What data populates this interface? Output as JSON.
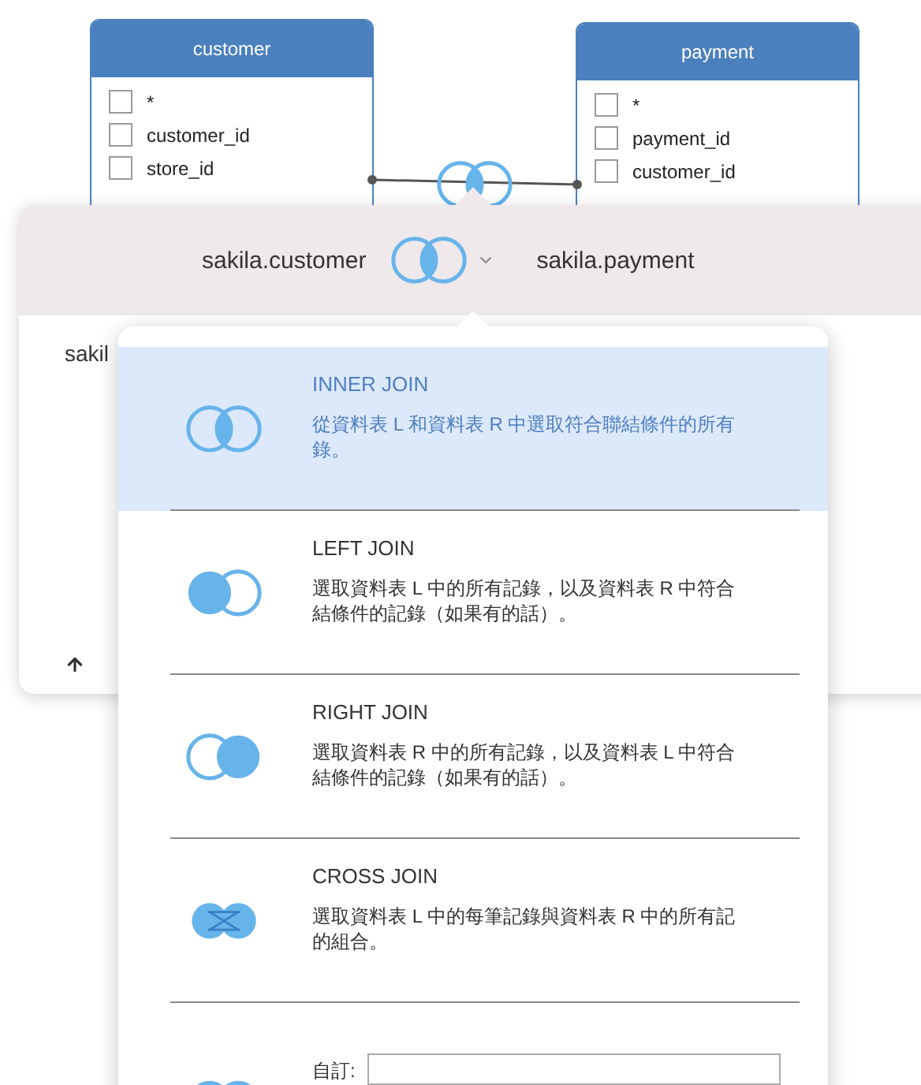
{
  "diagram": {
    "tables": [
      {
        "name": "customer",
        "columns": [
          {
            "label": "*",
            "checked": false
          },
          {
            "label": "customer_id",
            "checked": false
          },
          {
            "label": "store_id",
            "checked": false
          }
        ]
      },
      {
        "name": "payment",
        "columns": [
          {
            "label": "*",
            "checked": false
          },
          {
            "label": "payment_id",
            "checked": false
          },
          {
            "label": "customer_id",
            "checked": false
          }
        ]
      }
    ],
    "kind": "inner"
  },
  "join_bar": {
    "left_table": "sakila.customer",
    "right_table": "sakila.payment",
    "kind": "inner"
  },
  "panel": {
    "text": "sakil"
  },
  "join_menu": {
    "items": [
      {
        "kind": "inner",
        "name": "INNER JOIN",
        "description": [
          "從資料表 L 和資料表 R 中選取符合聯結條件的所有",
          "錄。"
        ],
        "selected": true
      },
      {
        "kind": "left",
        "name": "LEFT JOIN",
        "description": [
          "選取資料表 L 中的所有記錄，以及資料表 R 中符合",
          "結條件的記錄（如果有的話）。"
        ],
        "selected": false
      },
      {
        "kind": "right",
        "name": "RIGHT JOIN",
        "description": [
          "選取資料表 R 中的所有記錄，以及資料表 L 中符合",
          "結條件的記錄（如果有的話）。"
        ],
        "selected": false
      },
      {
        "kind": "cross",
        "name": "CROSS JOIN",
        "description": [
          "選取資料表 L 中的每筆記錄與資料表 R 中的所有記",
          "的組合。"
        ],
        "selected": false
      },
      {
        "kind": "custom",
        "label": "自訂:",
        "selected": false
      }
    ]
  }
}
